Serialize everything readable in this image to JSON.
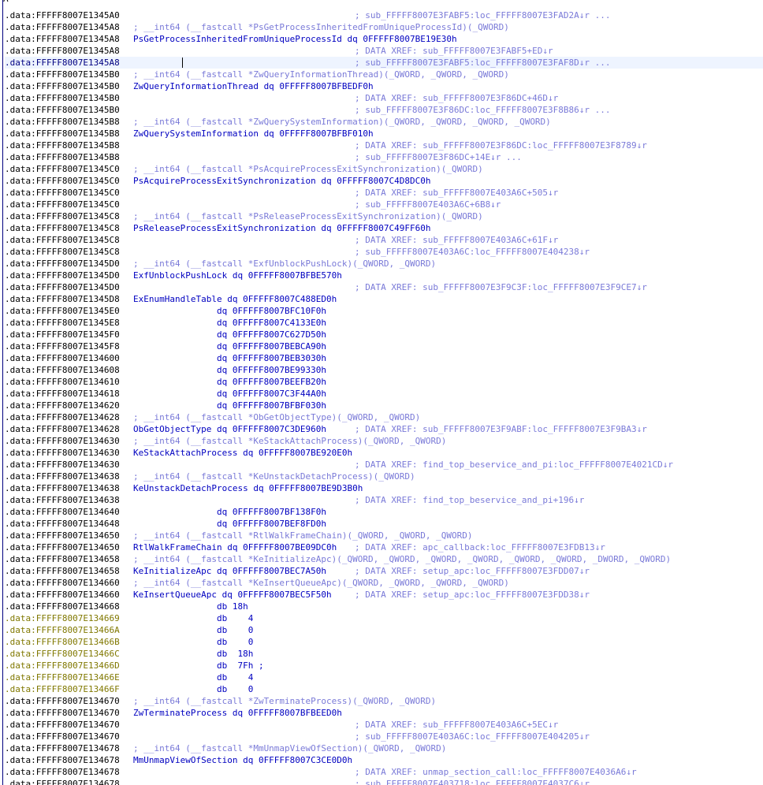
{
  "view": {
    "top_char": "A"
  },
  "lines": [
    {
      "addr": ".data:FFFFF8007E1345A0",
      "code": "",
      "comment": "; sub_FFFFF8007E3FABF5:loc_FFFFF8007E3FAD2A↓r ..."
    },
    {
      "addr": ".data:FFFFF8007E1345A8",
      "code": "",
      "comment": "; __int64 (__fastcall *PsGetProcessInheritedFromUniqueProcessId)(_QWORD)"
    },
    {
      "addr": ".data:FFFFF8007E1345A8",
      "code": "PsGetProcessInheritedFromUniqueProcessId dq 0FFFFF8007BE19E30h",
      "comment": ""
    },
    {
      "addr": ".data:FFFFF8007E1345A8",
      "code": "",
      "comment": "; DATA XREF: sub_FFFFF8007E3FABF5+ED↓r"
    },
    {
      "addr": ".data:FFFFF8007E1345A8",
      "code": "",
      "comment": "; sub_FFFFF8007E3FABF5:loc_FFFFF8007E3FAF8D↓r ..."
    },
    {
      "addr": ".data:FFFFF8007E1345B0",
      "code": "",
      "comment": "; __int64 (__fastcall *ZwQueryInformationThread)(_QWORD, _QWORD, _QWORD)"
    },
    {
      "addr": ".data:FFFFF8007E1345B0",
      "code": "ZwQueryInformationThread dq 0FFFFF8007BFBEDF0h",
      "comment": ""
    },
    {
      "addr": ".data:FFFFF8007E1345B0",
      "code": "",
      "comment": "; DATA XREF: sub_FFFFF8007E3F86DC+46D↓r"
    },
    {
      "addr": ".data:FFFFF8007E1345B0",
      "code": "",
      "comment": "; sub_FFFFF8007E3F86DC:loc_FFFFF8007E3F8B86↓r ..."
    },
    {
      "addr": ".data:FFFFF8007E1345B8",
      "code": "",
      "comment": "; __int64 (__fastcall *ZwQuerySystemInformation)(_QWORD, _QWORD, _QWORD, _QWORD)"
    },
    {
      "addr": ".data:FFFFF8007E1345B8",
      "code": "ZwQuerySystemInformation dq 0FFFFF8007BFBF010h",
      "comment": ""
    },
    {
      "addr": ".data:FFFFF8007E1345B8",
      "code": "",
      "comment": "; DATA XREF: sub_FFFFF8007E3F86DC:loc_FFFFF8007E3F8789↓r"
    },
    {
      "addr": ".data:FFFFF8007E1345B8",
      "code": "",
      "comment": "; sub_FFFFF8007E3F86DC+14E↓r ..."
    },
    {
      "addr": ".data:FFFFF8007E1345C0",
      "code": "",
      "comment": "; __int64 (__fastcall *PsAcquireProcessExitSynchronization)(_QWORD)"
    },
    {
      "addr": ".data:FFFFF8007E1345C0",
      "code": "PsAcquireProcessExitSynchronization dq 0FFFFF8007C4D8DC0h",
      "comment": ""
    },
    {
      "addr": ".data:FFFFF8007E1345C0",
      "code": "",
      "comment": "; DATA XREF: sub_FFFFF8007E403A6C+505↓r"
    },
    {
      "addr": ".data:FFFFF8007E1345C0",
      "code": "",
      "comment": "; sub_FFFFF8007E403A6C+6B8↓r"
    },
    {
      "addr": ".data:FFFFF8007E1345C8",
      "code": "",
      "comment": "; __int64 (__fastcall *PsReleaseProcessExitSynchronization)(_QWORD)"
    },
    {
      "addr": ".data:FFFFF8007E1345C8",
      "code": "PsReleaseProcessExitSynchronization dq 0FFFFF8007C49FF60h",
      "comment": ""
    },
    {
      "addr": ".data:FFFFF8007E1345C8",
      "code": "",
      "comment": "; DATA XREF: sub_FFFFF8007E403A6C+61F↓r"
    },
    {
      "addr": ".data:FFFFF8007E1345C8",
      "code": "",
      "comment": "; sub_FFFFF8007E403A6C:loc_FFFFF8007E404238↓r"
    },
    {
      "addr": ".data:FFFFF8007E1345D0",
      "code": "",
      "comment": "; __int64 (__fastcall *ExfUnblockPushLock)(_QWORD, _QWORD)"
    },
    {
      "addr": ".data:FFFFF8007E1345D0",
      "code": "ExfUnblockPushLock dq 0FFFFF8007BFBE570h",
      "comment": ""
    },
    {
      "addr": ".data:FFFFF8007E1345D0",
      "code": "",
      "comment": "; DATA XREF: sub_FFFFF8007E3F9C3F:loc_FFFFF8007E3F9CE7↓r"
    },
    {
      "addr": ".data:FFFFF8007E1345D8",
      "code": "ExEnumHandleTable dq 0FFFFF8007C488ED0h",
      "comment": ""
    },
    {
      "addr": ".data:FFFFF8007E1345E0",
      "code": "                dq 0FFFFF8007BFC10F0h",
      "comment": ""
    },
    {
      "addr": ".data:FFFFF8007E1345E8",
      "code": "                dq 0FFFFF8007C4133E0h",
      "comment": ""
    },
    {
      "addr": ".data:FFFFF8007E1345F0",
      "code": "                dq 0FFFFF8007C627D50h",
      "comment": ""
    },
    {
      "addr": ".data:FFFFF8007E1345F8",
      "code": "                dq 0FFFFF8007BEBCA90h",
      "comment": ""
    },
    {
      "addr": ".data:FFFFF8007E134600",
      "code": "                dq 0FFFFF8007BEB3030h",
      "comment": ""
    },
    {
      "addr": ".data:FFFFF8007E134608",
      "code": "                dq 0FFFFF8007BE99330h",
      "comment": ""
    },
    {
      "addr": ".data:FFFFF8007E134610",
      "code": "                dq 0FFFFF8007BEEFB20h",
      "comment": ""
    },
    {
      "addr": ".data:FFFFF8007E134618",
      "code": "                dq 0FFFFF8007C3F44A0h",
      "comment": ""
    },
    {
      "addr": ".data:FFFFF8007E134620",
      "code": "                dq 0FFFFF8007BFBF030h",
      "comment": ""
    },
    {
      "addr": ".data:FFFFF8007E134628",
      "code": "",
      "comment": "; __int64 (__fastcall *ObGetObjectType)(_QWORD, _QWORD)"
    },
    {
      "addr": ".data:FFFFF8007E134628",
      "code": "ObGetObjectType dq 0FFFFF8007C3DE960h",
      "comment": "; DATA XREF: sub_FFFFF8007E3F9ABF:loc_FFFFF8007E3F9BA3↓r"
    },
    {
      "addr": ".data:FFFFF8007E134630",
      "code": "",
      "comment": "; __int64 (__fastcall *KeStackAttachProcess)(_QWORD, _QWORD)"
    },
    {
      "addr": ".data:FFFFF8007E134630",
      "code": "KeStackAttachProcess dq 0FFFFF8007BE920E0h",
      "comment": ""
    },
    {
      "addr": ".data:FFFFF8007E134630",
      "code": "",
      "comment": "; DATA XREF: find_top_beservice_and_pi:loc_FFFFF8007E4021CD↓r"
    },
    {
      "addr": ".data:FFFFF8007E134638",
      "code": "",
      "comment": "; __int64 (__fastcall *KeUnstackDetachProcess)(_QWORD)"
    },
    {
      "addr": ".data:FFFFF8007E134638",
      "code": "KeUnstackDetachProcess dq 0FFFFF8007BE9D3B0h",
      "comment": ""
    },
    {
      "addr": ".data:FFFFF8007E134638",
      "code": "",
      "comment": "; DATA XREF: find_top_beservice_and_pi+196↓r"
    },
    {
      "addr": ".data:FFFFF8007E134640",
      "code": "                dq 0FFFFF8007BF138F0h",
      "comment": ""
    },
    {
      "addr": ".data:FFFFF8007E134648",
      "code": "                dq 0FFFFF8007BEF8FD0h",
      "comment": ""
    },
    {
      "addr": ".data:FFFFF8007E134650",
      "code": "",
      "comment": "; __int64 (__fastcall *RtlWalkFrameChain)(_QWORD, _QWORD, _QWORD)"
    },
    {
      "addr": ".data:FFFFF8007E134650",
      "code": "RtlWalkFrameChain dq 0FFFFF8007BE09DC0h",
      "comment": "; DATA XREF: apc_callback:loc_FFFFF8007E3FDB13↓r"
    },
    {
      "addr": ".data:FFFFF8007E134658",
      "code": "",
      "comment": "; __int64 (__fastcall *KeInitializeApc)(_QWORD, _QWORD, _QWORD, _QWORD, _QWORD, _QWORD, _DWORD, _QWORD)"
    },
    {
      "addr": ".data:FFFFF8007E134658",
      "code": "KeInitializeApc dq 0FFFFF8007BEC7A50h",
      "comment": "; DATA XREF: setup_apc:loc_FFFFF8007E3FDD07↓r"
    },
    {
      "addr": ".data:FFFFF8007E134660",
      "code": "",
      "comment": "; __int64 (__fastcall *KeInsertQueueApc)(_QWORD, _QWORD, _QWORD, _QWORD)"
    },
    {
      "addr": ".data:FFFFF8007E134660",
      "code": "KeInsertQueueApc dq 0FFFFF8007BEC5F50h",
      "comment": "; DATA XREF: setup_apc:loc_FFFFF8007E3FDD38↓r"
    },
    {
      "addr": ".data:FFFFF8007E134668",
      "code": "                db 18h",
      "comment": ""
    },
    {
      "addr": ".data:FFFFF8007E134669",
      "code": "                db    4",
      "comment": "",
      "hl": true
    },
    {
      "addr": ".data:FFFFF8007E13466A",
      "code": "                db    0",
      "comment": "",
      "hl": true
    },
    {
      "addr": ".data:FFFFF8007E13466B",
      "code": "                db    0",
      "comment": "",
      "hl": true
    },
    {
      "addr": ".data:FFFFF8007E13466C",
      "code": "                db  18h",
      "comment": "",
      "hl": true
    },
    {
      "addr": ".data:FFFFF8007E13466D",
      "code": "                db  7Fh ;",
      "comment": "",
      "hl": true
    },
    {
      "addr": ".data:FFFFF8007E13466E",
      "code": "                db    4",
      "comment": "",
      "hl": true
    },
    {
      "addr": ".data:FFFFF8007E13466F",
      "code": "                db    0",
      "comment": "",
      "hl": true
    },
    {
      "addr": ".data:FFFFF8007E134670",
      "code": "",
      "comment": "; __int64 (__fastcall *ZwTerminateProcess)(_QWORD, _QWORD)"
    },
    {
      "addr": ".data:FFFFF8007E134670",
      "code": "ZwTerminateProcess dq 0FFFFF8007BFBEED0h",
      "comment": ""
    },
    {
      "addr": ".data:FFFFF8007E134670",
      "code": "",
      "comment": "; DATA XREF: sub_FFFFF8007E403A6C+5EC↓r"
    },
    {
      "addr": ".data:FFFFF8007E134670",
      "code": "",
      "comment": "; sub_FFFFF8007E403A6C:loc_FFFFF8007E404205↓r"
    },
    {
      "addr": ".data:FFFFF8007E134678",
      "code": "",
      "comment": "; __int64 (__fastcall *MmUnmapViewOfSection)(_QWORD, _QWORD)"
    },
    {
      "addr": ".data:FFFFF8007E134678",
      "code": "MmUnmapViewOfSection dq 0FFFFF8007C3CE0D0h",
      "comment": ""
    },
    {
      "addr": ".data:FFFFF8007E134678",
      "code": "",
      "comment": "; DATA XREF: unmap_section_call:loc_FFFFF8007E4036A6↓r"
    },
    {
      "addr": ".data:FFFFF8007E134678",
      "code": "",
      "comment": "; sub_FFFFF8007E403718:loc_FFFFF8007E4037C6↓r"
    }
  ]
}
